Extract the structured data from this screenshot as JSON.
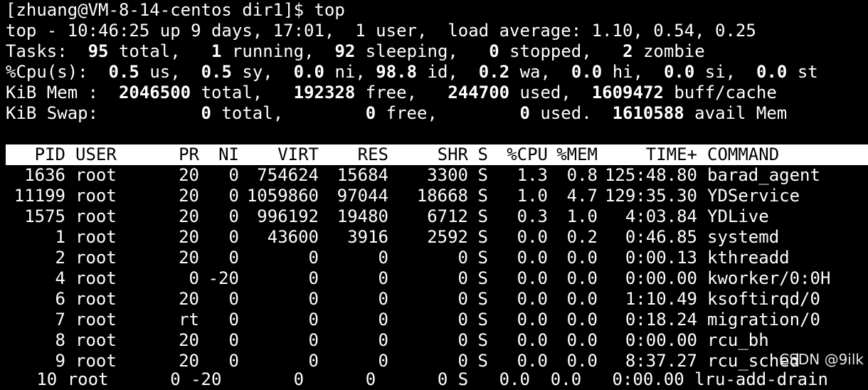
{
  "prompt": "[zhuang@VM-8-14-centos dir1]$ top",
  "summary": {
    "uptime_prefix": "top - 10:46:25 up 9 days, 17:01,  1 user,  load average: 1.10, 0.54, 0.25",
    "tasks": {
      "label": "Tasks:",
      "total": "95",
      "total_label": "total,",
      "running": "1",
      "running_label": "running,",
      "sleeping": "92",
      "sleeping_label": "sleeping,",
      "stopped": "0",
      "stopped_label": "stopped,",
      "zombie": "2",
      "zombie_label": "zombie"
    },
    "cpu": {
      "label": "%Cpu(s):",
      "us": "0.5",
      "us_label": "us,",
      "sy": "0.5",
      "sy_label": "sy,",
      "ni": "0.0",
      "ni_label": "ni,",
      "id": "98.8",
      "id_label": "id,",
      "wa": "0.2",
      "wa_label": "wa,",
      "hi": "0.0",
      "hi_label": "hi,",
      "si": "0.0",
      "si_label": "si,",
      "st": "0.0",
      "st_label": "st"
    },
    "mem": {
      "label": "KiB Mem :",
      "total": "2046500",
      "total_label": "total,",
      "free": "192328",
      "free_label": "free,",
      "used": "244700",
      "used_label": "used,",
      "buff": "1609472",
      "buff_label": "buff/cache"
    },
    "swap": {
      "label": "KiB Swap:",
      "total": "0",
      "total_label": "total,",
      "free": "0",
      "free_label": "free,",
      "used": "0",
      "used_label": "used.",
      "avail": "1610588",
      "avail_label": "avail Mem"
    }
  },
  "columns": [
    "PID",
    "USER",
    "PR",
    "NI",
    "VIRT",
    "RES",
    "SHR",
    "S",
    "%CPU",
    "%MEM",
    "TIME+",
    "COMMAND"
  ],
  "processes": [
    {
      "pid": "1636",
      "user": "root",
      "pr": "20",
      "ni": "0",
      "virt": "754624",
      "res": "15684",
      "shr": "3300",
      "s": "S",
      "cpu": "1.3",
      "mem": "0.8",
      "time": "125:48.80",
      "cmd": "barad_agent"
    },
    {
      "pid": "11199",
      "user": "root",
      "pr": "20",
      "ni": "0",
      "virt": "1059860",
      "res": "97044",
      "shr": "18668",
      "s": "S",
      "cpu": "1.0",
      "mem": "4.7",
      "time": "129:35.30",
      "cmd": "YDService"
    },
    {
      "pid": "1575",
      "user": "root",
      "pr": "20",
      "ni": "0",
      "virt": "996192",
      "res": "19480",
      "shr": "6712",
      "s": "S",
      "cpu": "0.3",
      "mem": "1.0",
      "time": "4:03.84",
      "cmd": "YDLive"
    },
    {
      "pid": "1",
      "user": "root",
      "pr": "20",
      "ni": "0",
      "virt": "43600",
      "res": "3916",
      "shr": "2592",
      "s": "S",
      "cpu": "0.0",
      "mem": "0.2",
      "time": "0:46.85",
      "cmd": "systemd"
    },
    {
      "pid": "2",
      "user": "root",
      "pr": "20",
      "ni": "0",
      "virt": "0",
      "res": "0",
      "shr": "0",
      "s": "S",
      "cpu": "0.0",
      "mem": "0.0",
      "time": "0:00.13",
      "cmd": "kthreadd"
    },
    {
      "pid": "4",
      "user": "root",
      "pr": "0",
      "ni": "-20",
      "virt": "0",
      "res": "0",
      "shr": "0",
      "s": "S",
      "cpu": "0.0",
      "mem": "0.0",
      "time": "0:00.00",
      "cmd": "kworker/0:0H"
    },
    {
      "pid": "6",
      "user": "root",
      "pr": "20",
      "ni": "0",
      "virt": "0",
      "res": "0",
      "shr": "0",
      "s": "S",
      "cpu": "0.0",
      "mem": "0.0",
      "time": "1:10.49",
      "cmd": "ksoftirqd/0"
    },
    {
      "pid": "7",
      "user": "root",
      "pr": "rt",
      "ni": "0",
      "virt": "0",
      "res": "0",
      "shr": "0",
      "s": "S",
      "cpu": "0.0",
      "mem": "0.0",
      "time": "0:18.24",
      "cmd": "migration/0"
    },
    {
      "pid": "8",
      "user": "root",
      "pr": "20",
      "ni": "0",
      "virt": "0",
      "res": "0",
      "shr": "0",
      "s": "S",
      "cpu": "0.0",
      "mem": "0.0",
      "time": "0:00.00",
      "cmd": "rcu_bh"
    },
    {
      "pid": "9",
      "user": "root",
      "pr": "20",
      "ni": "0",
      "virt": "0",
      "res": "0",
      "shr": "0",
      "s": "S",
      "cpu": "0.0",
      "mem": "0.0",
      "time": "8:37.27",
      "cmd": "rcu_sched"
    }
  ],
  "partial_row": "   10 root      0 -20       0      0      0 S   0.0  0.0   0:00.00 lru-add-drain",
  "watermark": "CSDN @9ilk",
  "colors": {
    "background": "#000000",
    "foreground": "#ffffff",
    "header_bg": "#ffffff",
    "header_fg": "#000000"
  }
}
